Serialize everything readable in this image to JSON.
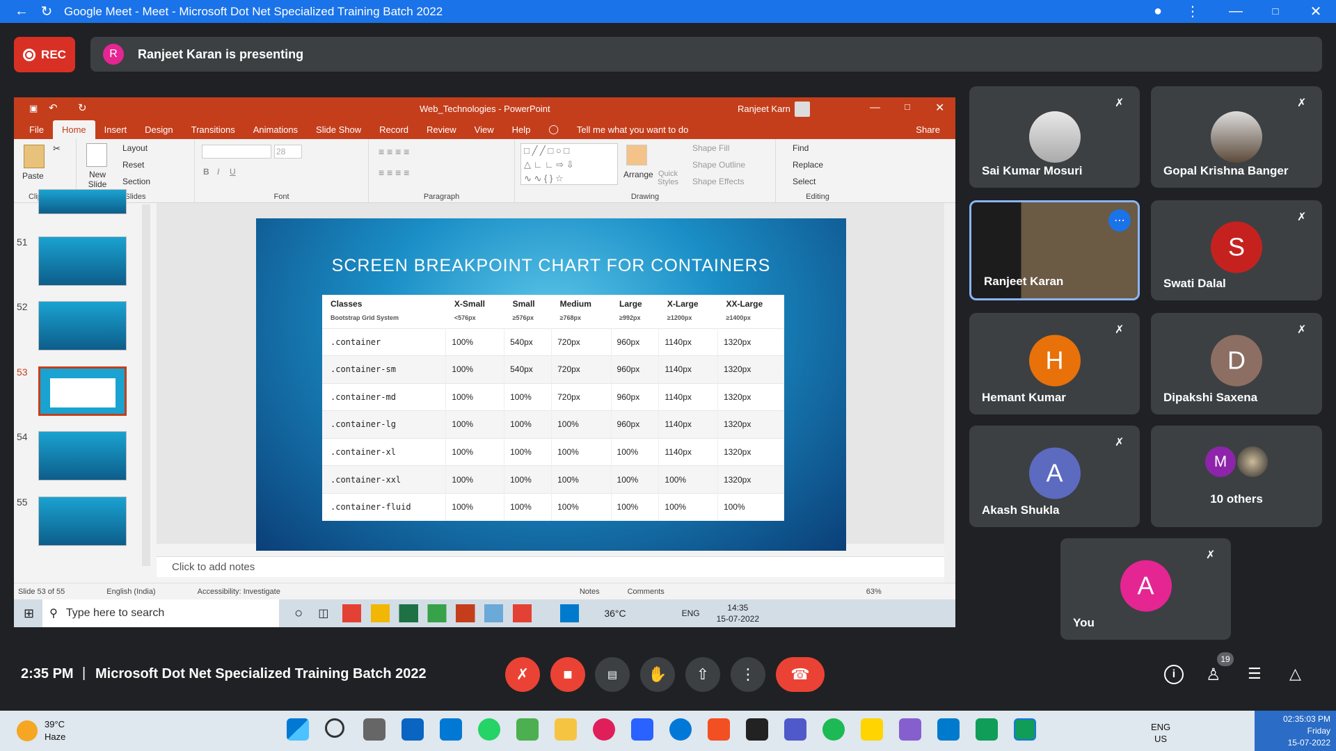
{
  "window": {
    "title": "Google Meet - Meet - Microsoft Dot Net Specialized Training Batch 2022"
  },
  "rec": {
    "label": "REC"
  },
  "presenting": {
    "avatar_letter": "R",
    "text": "Ranjeet Karan is presenting"
  },
  "ppt": {
    "title": "Web_Technologies - PowerPoint",
    "user": "Ranjeet Karn",
    "tabs": [
      "File",
      "Home",
      "Insert",
      "Design",
      "Transitions",
      "Animations",
      "Slide Show",
      "Record",
      "Review",
      "View",
      "Help"
    ],
    "tell_me": "Tell me what you want to do",
    "share": "Share",
    "ribbon": {
      "paste": "Paste",
      "clipboard": "Clipboard",
      "new_slide": "New Slide",
      "layout": "Layout",
      "reset": "Reset",
      "section": "Section",
      "slides": "Slides",
      "font_size": "28",
      "font": "Font",
      "paragraph": "Paragraph",
      "arrange": "Arrange",
      "quick_styles": "Quick Styles",
      "shape_fill": "Shape Fill",
      "shape_outline": "Shape Outline",
      "shape_effects": "Shape Effects",
      "drawing": "Drawing",
      "find": "Find",
      "replace": "Replace",
      "select": "Select",
      "editing": "Editing"
    },
    "thumb_numbers": [
      "51",
      "52",
      "53",
      "54",
      "55"
    ],
    "notes_placeholder": "Click to add notes",
    "status": {
      "slide": "Slide 53 of 55",
      "lang": "English (India)",
      "access": "Accessibility: Investigate",
      "notes": "Notes",
      "comments": "Comments",
      "zoom": "63%"
    }
  },
  "slide": {
    "title": "SCREEN BREAKPOINT CHART FOR CONTAINERS",
    "headers": [
      {
        "t": "Classes",
        "s": "Bootstrap  Grid System"
      },
      {
        "t": "X-Small",
        "s": "<576px"
      },
      {
        "t": "Small",
        "s": "≥576px"
      },
      {
        "t": "Medium",
        "s": "≥768px"
      },
      {
        "t": "Large",
        "s": "≥992px"
      },
      {
        "t": "X-Large",
        "s": "≥1200px"
      },
      {
        "t": "XX-Large",
        "s": "≥1400px"
      }
    ],
    "rows": [
      [
        ".container",
        "100%",
        "540px",
        "720px",
        "960px",
        "1140px",
        "1320px"
      ],
      [
        ".container-sm",
        "100%",
        "540px",
        "720px",
        "960px",
        "1140px",
        "1320px"
      ],
      [
        ".container-md",
        "100%",
        "100%",
        "720px",
        "960px",
        "1140px",
        "1320px"
      ],
      [
        ".container-lg",
        "100%",
        "100%",
        "100%",
        "960px",
        "1140px",
        "1320px"
      ],
      [
        ".container-xl",
        "100%",
        "100%",
        "100%",
        "100%",
        "1140px",
        "1320px"
      ],
      [
        ".container-xxl",
        "100%",
        "100%",
        "100%",
        "100%",
        "100%",
        "1320px"
      ],
      [
        ".container-fluid",
        "100%",
        "100%",
        "100%",
        "100%",
        "100%",
        "100%"
      ]
    ]
  },
  "inner_taskbar": {
    "search": "Type here to search",
    "temp": "36°C",
    "lang": "ENG",
    "time": "14:35",
    "date": "15-07-2022"
  },
  "participants": [
    {
      "name": "Sai Kumar Mosuri"
    },
    {
      "name": "Gopal Krishna Banger"
    },
    {
      "name": "Ranjeet Karan"
    },
    {
      "name": "Swati Dalal",
      "letter": "S",
      "color": "#c5221f"
    },
    {
      "name": "Hemant Kumar",
      "letter": "H",
      "color": "#e8710a"
    },
    {
      "name": "Dipakshi Saxena",
      "letter": "D",
      "color": "#8d6e63"
    },
    {
      "name": "Akash Shukla",
      "letter": "A",
      "color": "#5c6bc0"
    },
    {
      "name": "10 others",
      "letter": "M",
      "color": "#8e24aa"
    },
    {
      "name": "You",
      "letter": "A",
      "color": "#e52592"
    }
  ],
  "meeting": {
    "time": "2:35 PM",
    "separator": "|",
    "name": "Microsoft Dot Net Specialized Training Batch 2022",
    "people_count": "19"
  },
  "taskbar": {
    "temp": "39°C",
    "weather": "Haze",
    "lang1": "ENG",
    "lang2": "US",
    "time": "02:35:03 PM",
    "day": "Friday",
    "date": "15-07-2022"
  }
}
